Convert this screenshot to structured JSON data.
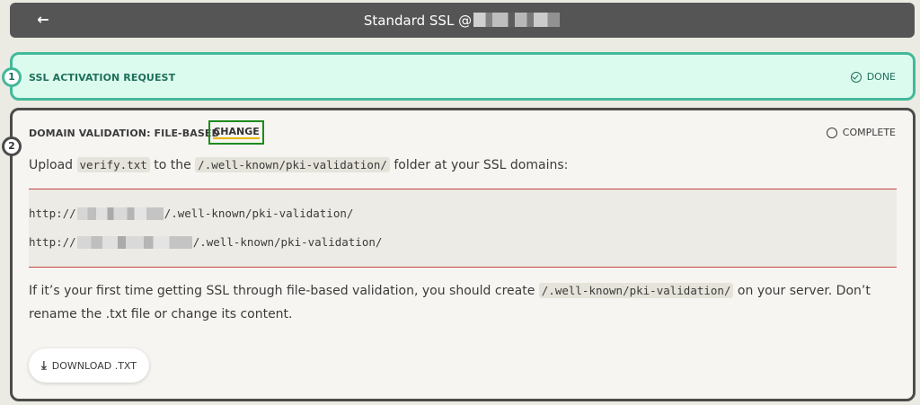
{
  "header": {
    "back_icon": "arrow-left-icon",
    "title_prefix": "Standard SSL @"
  },
  "steps": [
    {
      "number": "1",
      "title": "SSL ACTIVATION REQUEST",
      "status": "DONE",
      "status_icon": "check-circle-icon",
      "accent": "#43b99a",
      "background": "#dcfbef"
    },
    {
      "number": "2",
      "title": "DOMAIN VALIDATION: FILE-BASED",
      "change_label": "CHANGE",
      "status": "COMPLETE",
      "status_icon": "circle-outline-icon",
      "accent": "#4b4b4b"
    }
  ],
  "validation": {
    "upload_text_1": "Upload ",
    "filename": "verify.txt",
    "upload_text_2": " to the ",
    "folder": "/.well-known/pki-validation/",
    "upload_text_3": " folder at your SSL domains:",
    "urls": [
      {
        "prefix": "http://",
        "suffix": "/.well-known/pki-validation/"
      },
      {
        "prefix": "http://",
        "suffix": "/.well-known/pki-validation/"
      }
    ],
    "info_text_1": "If it’s your first time getting SSL through file-based validation, you should create ",
    "info_code": "/.well-known/pki-validation/",
    "info_text_2": " on your server. Don’t rename the .txt file or change its content.",
    "download_icon": "download-icon",
    "download_label": "DOWNLOAD .TXT"
  }
}
